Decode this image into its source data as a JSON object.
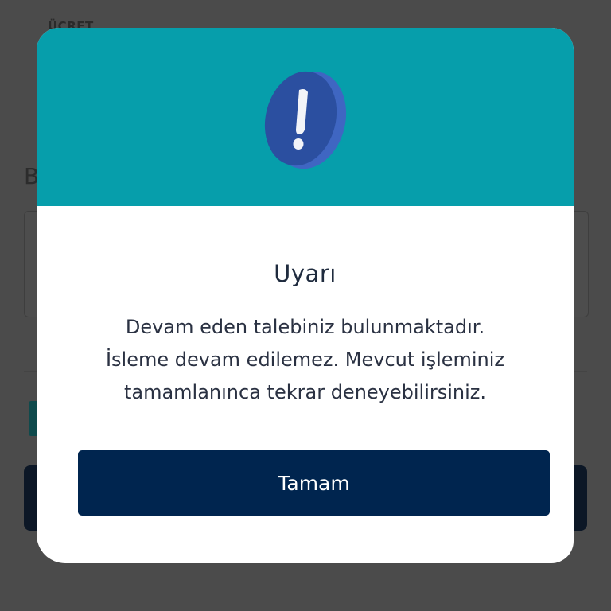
{
  "background": {
    "label": "ÜCRET",
    "heading": "B"
  },
  "modal": {
    "title": "Uyarı",
    "message_lines": [
      "Devam eden talebiniz bulunmaktadır.",
      "İsleme devam edilemez. Mevcut işleminiz",
      "tamamlanınca tekrar deneyebilirsiniz."
    ],
    "ok_label": "Tamam",
    "icon": "exclamation-icon"
  },
  "colors": {
    "header": "#069eab",
    "button": "#00254f",
    "icon_face": "#2b4fa0",
    "icon_edge": "#3f66c2"
  }
}
